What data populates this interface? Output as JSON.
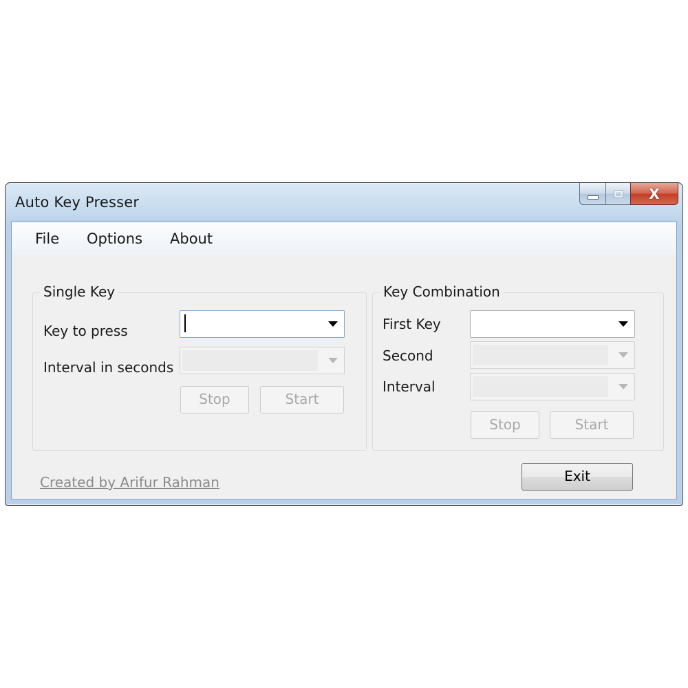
{
  "window": {
    "title": "Auto Key Presser",
    "close_glyph": "X"
  },
  "menu": {
    "items": [
      "File",
      "Options",
      "About"
    ]
  },
  "single_key": {
    "group_title": "Single Key",
    "key_label": "Key to press",
    "interval_label": "Interval in seconds",
    "key_value": "",
    "interval_value": "",
    "stop_label": "Stop",
    "start_label": "Start"
  },
  "key_combination": {
    "group_title": "Key Combination",
    "first_label": "First Key",
    "second_label": "Second",
    "interval_label": "Interval",
    "first_value": "",
    "second_value": "",
    "interval_value": "",
    "stop_label": "Stop",
    "start_label": "Start"
  },
  "footer": {
    "credit_link": "Created by Arifur Rahman",
    "exit_label": "Exit"
  },
  "icons": {
    "minimize": "minimize-icon",
    "maximize": "maximize-icon",
    "close": "close-icon",
    "dropdown": "chevron-down-icon"
  }
}
